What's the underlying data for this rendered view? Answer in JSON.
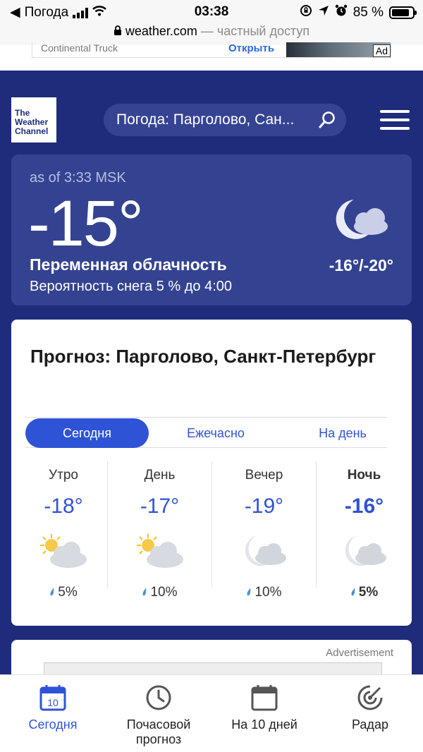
{
  "status_bar": {
    "carrier": "Погода",
    "time": "03:38",
    "battery": "85 %"
  },
  "url_bar": {
    "host": "weather.com",
    "privacy": "— частный доступ"
  },
  "top_ad": {
    "title": "Continental Truck",
    "action": "Открыть",
    "tag": "Ad"
  },
  "header": {
    "logo_text": [
      "The",
      "Weather",
      "Channel"
    ],
    "search_value": "Погода: Парголово, Сан..."
  },
  "current": {
    "as_of": "as of 3:33 MSK",
    "temperature": "-15°",
    "phrase": "Переменная облачность",
    "precip": "Вероятность снега 5 % до 4:00",
    "hilo": "-16°/-20°",
    "icon": "partly-cloudy-night-icon"
  },
  "forecast": {
    "title": "Прогноз: Парголово, Санкт-Петербург",
    "tabs": [
      "Сегодня",
      "Ежечасно",
      "На день"
    ],
    "active_tab": 0,
    "periods": [
      {
        "name": "Утро",
        "temp": "-18°",
        "chance": "5%",
        "icon": "partly-cloudy-day-icon"
      },
      {
        "name": "День",
        "temp": "-17°",
        "chance": "10%",
        "icon": "partly-cloudy-day-icon"
      },
      {
        "name": "Вечер",
        "temp": "-19°",
        "chance": "10%",
        "icon": "partly-cloudy-night-icon"
      },
      {
        "name": "Ночь",
        "temp": "-16°",
        "chance": "5%",
        "icon": "partly-cloudy-night-icon"
      }
    ]
  },
  "ad_card": {
    "label": "Advertisement"
  },
  "bottom_nav": {
    "items": [
      {
        "label": "Сегодня",
        "icon": "calendar-today-icon",
        "badge": "10"
      },
      {
        "label": "Почасовой прогноз",
        "icon": "clock-icon"
      },
      {
        "label": "На 10 дней",
        "icon": "calendar-icon"
      },
      {
        "label": "Радар",
        "icon": "radar-icon"
      }
    ],
    "active": 0
  },
  "colors": {
    "page_bg": "#1f2c7c",
    "panel_bg": "#344391",
    "accent": "#2f53d6"
  }
}
